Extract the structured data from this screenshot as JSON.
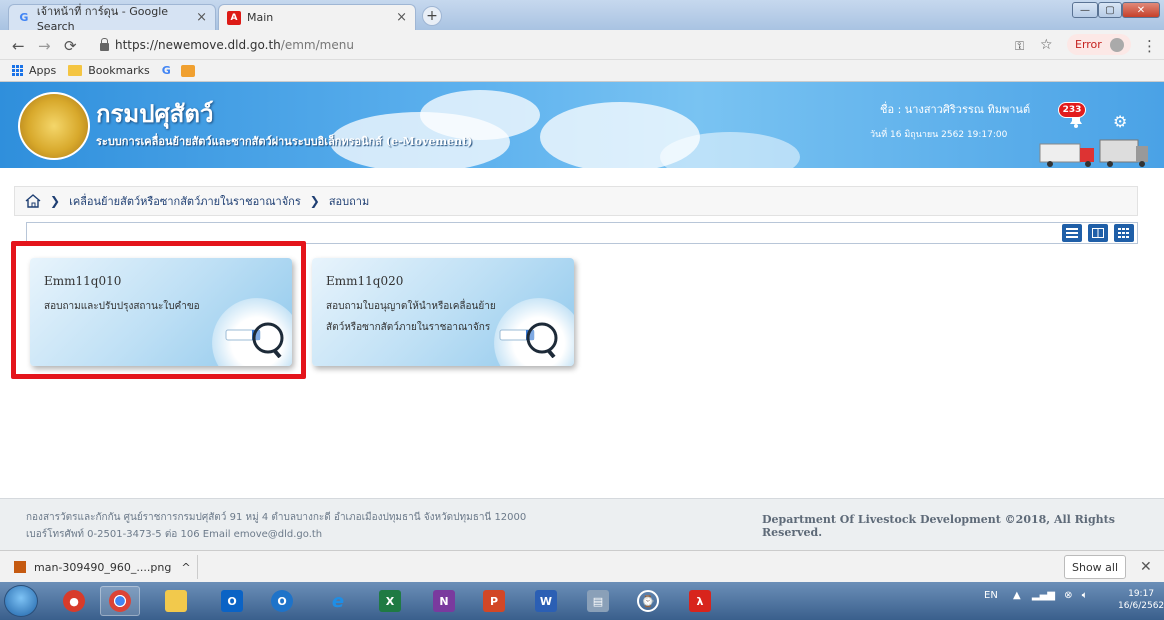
{
  "browser": {
    "tabs": [
      {
        "label": "เจ้าหน้าที่ การ์ดุน - Google Search",
        "favicon": "google-g"
      },
      {
        "label": "Main",
        "favicon": "angular-a"
      }
    ],
    "url_host": "https://newemove.dld.go.th",
    "url_path": "/emm/menu",
    "error_label": "Error",
    "bookmarks": [
      {
        "label": "Apps"
      },
      {
        "label": "Bookmarks"
      }
    ]
  },
  "header": {
    "title": "กรมปศุสัตว์",
    "subtitle": "ระบบการเคลื่อนย้ายสัตว์และซากสัตว์ผ่านระบบอิเล็กทรอนิกส์ (e-Movement)",
    "user_line": "ชื่อ : นางสาวศิริวรรณ ทิมพานต์",
    "date_line": "วันที่ 16 มิถุนายน 2562 19:17:00",
    "notification_count": "233"
  },
  "breadcrumb": {
    "items": [
      "เคลื่อนย้ายสัตว์หรือซากสัตว์ภายในราชอาณาจักร",
      "สอบถาม"
    ]
  },
  "cards": [
    {
      "code": "Emm11q010",
      "description": "สอบถามและปรับปรุงสถานะใบคำขอ"
    },
    {
      "code": "Emm11q020",
      "description": "สอบถามใบอนุญาตให้นำหรือเคลื่อนย้ายสัตว์หรือซากสัตว์ภายในราชอาณาจักร",
      "line1": "สอบถามใบอนุญาตให้นำหรือเคลื่อนย้าย",
      "line2": "สัตว์หรือซากสัตว์ภายในราชอาณาจักร"
    }
  ],
  "footer": {
    "address": "กองสารวัตรและกักกัน ศูนย์ราชการกรมปศุสัตว์ 91 หมู่ 4 ตำบลบางกะดี อำเภอเมืองปทุมธานี จังหวัดปทุมธานี 12000",
    "contact": "เบอร์โทรศัพท์ 0-2501-3473-5 ต่อ 106 Email emove@dld.go.th",
    "copyright": "Department Of Livestock Development ©2018, All Rights Reserved."
  },
  "downloads": {
    "file": "man-309490_960_....png",
    "show_all": "Show all"
  },
  "taskbar": {
    "lang": "EN",
    "time": "19:17",
    "date": "16/6/2562"
  },
  "colors": {
    "header_blue": "#4aa2e6",
    "highlight_red": "#e4141b",
    "view_button": "#1f5fa8",
    "breadcrumb_text": "#1f3f73"
  }
}
